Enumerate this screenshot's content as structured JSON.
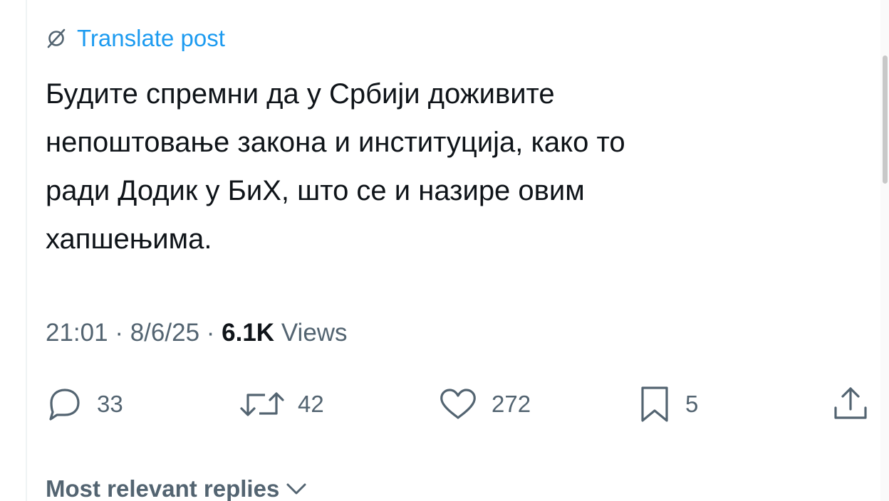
{
  "translate": {
    "label": "Translate post",
    "icon": "translate-icon",
    "color": "#1d9bf0"
  },
  "post": {
    "text": "Будите спремни да у Србији доживите\nнепоштовање закона и институција, како то\nради Додик у БиХ, што се и назире овим\nхапшењима."
  },
  "meta": {
    "time": "21:01",
    "separator": "·",
    "date": "8/6/25",
    "views_count": "6.1K",
    "views_label": "Views"
  },
  "actions": {
    "replies": {
      "icon": "reply-icon",
      "count": "33"
    },
    "reposts": {
      "icon": "repost-icon",
      "count": "42"
    },
    "likes": {
      "icon": "like-icon",
      "count": "272"
    },
    "bookmarks": {
      "icon": "bookmark-icon",
      "count": "5"
    },
    "share": {
      "icon": "share-icon"
    }
  },
  "replies_header": {
    "label": "Most relevant replies",
    "icon": "chevron-down-icon"
  },
  "colors": {
    "text_primary": "#0f1419",
    "text_secondary": "#536471",
    "accent": "#1d9bf0"
  }
}
